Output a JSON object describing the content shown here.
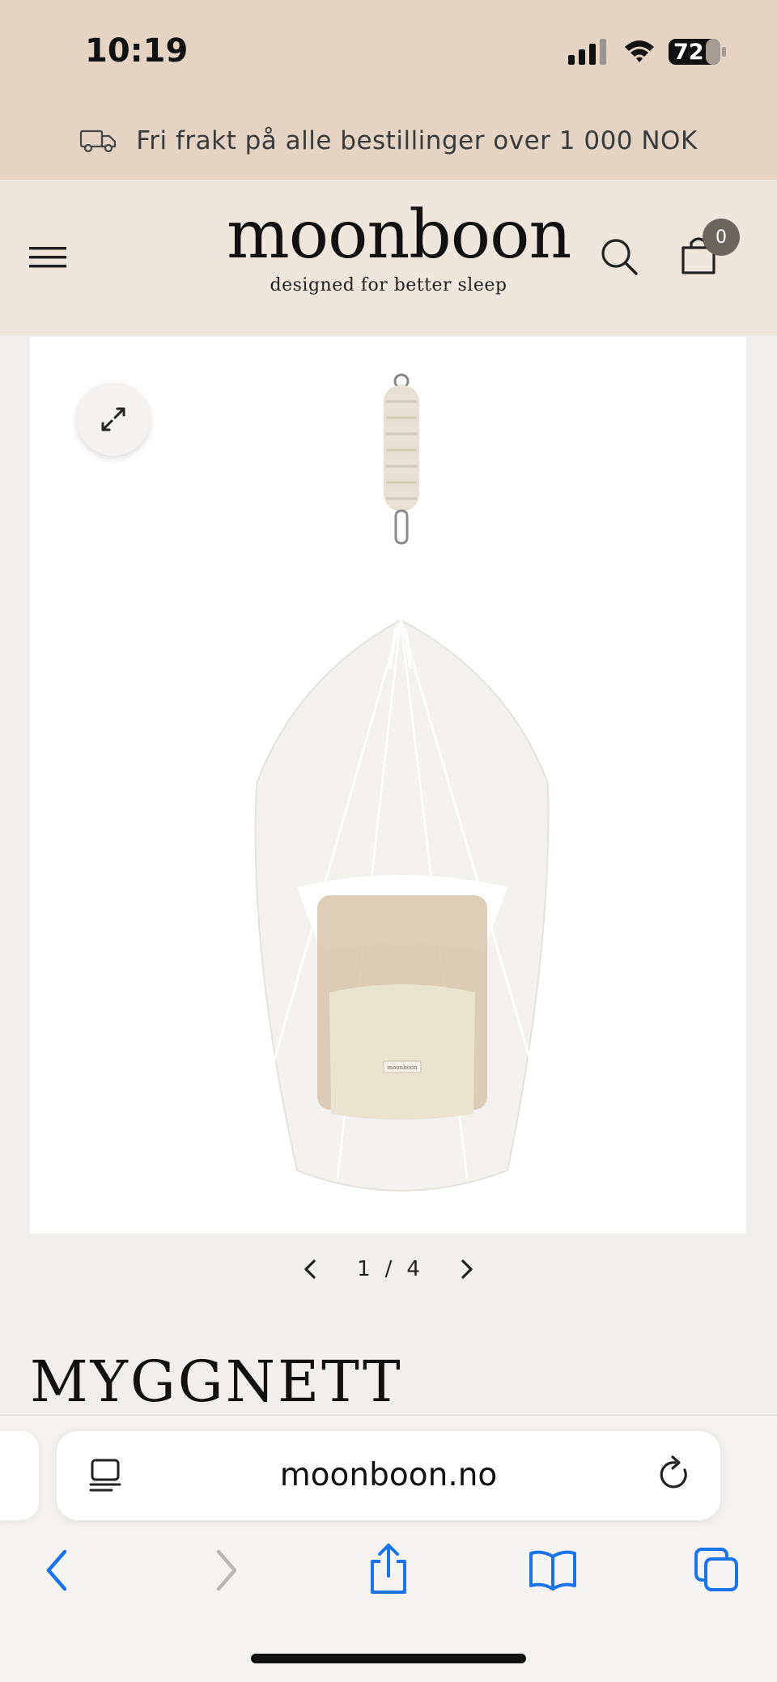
{
  "status_bar": {
    "time": "10:19",
    "battery": "72"
  },
  "announcement": {
    "text": "Fri frakt på alle bestillinger over 1 000 NOK",
    "icon": "truck-icon"
  },
  "header": {
    "logo_name": "moonboon",
    "logo_tagline": "designed for better sleep",
    "cart_count": "0"
  },
  "gallery": {
    "current": "1",
    "separator": "/",
    "total": "4"
  },
  "product": {
    "title": "MYGGNETT"
  },
  "browser": {
    "url": "moonboon.no"
  },
  "colors": {
    "topbar": "#e5d4c3",
    "header": "#efe6dc",
    "page": "#f1efed",
    "accent": "#1a73e8"
  }
}
